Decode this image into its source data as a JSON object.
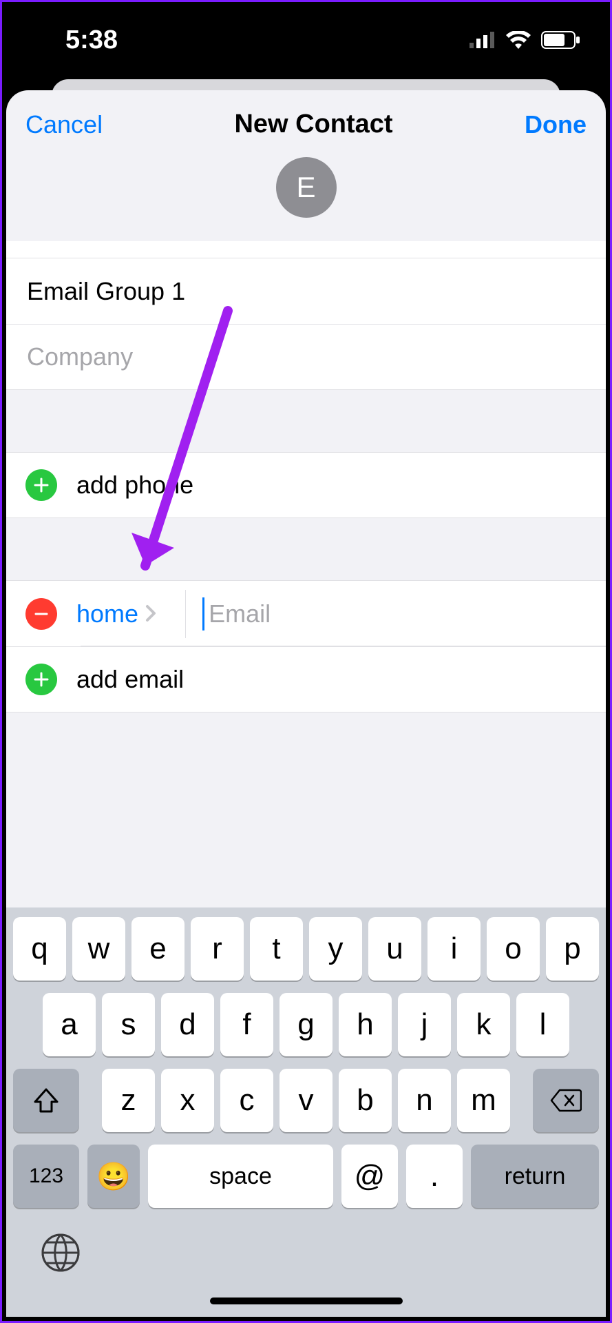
{
  "statusbar": {
    "time": "5:38"
  },
  "nav": {
    "cancel": "Cancel",
    "title": "New Contact",
    "done": "Done"
  },
  "avatar": {
    "initial": "E"
  },
  "name_field": {
    "value": "Email Group 1"
  },
  "company_field": {
    "placeholder": "Company",
    "value": ""
  },
  "phone_section": {
    "add_label": "add phone"
  },
  "email_section": {
    "type_label": "home",
    "email_placeholder": "Email",
    "email_value": "",
    "add_label": "add email"
  },
  "keyboard": {
    "row1": [
      "q",
      "w",
      "e",
      "r",
      "t",
      "y",
      "u",
      "i",
      "o",
      "p"
    ],
    "row2": [
      "a",
      "s",
      "d",
      "f",
      "g",
      "h",
      "j",
      "k",
      "l"
    ],
    "row3": [
      "z",
      "x",
      "c",
      "v",
      "b",
      "n",
      "m"
    ],
    "numkey": "123",
    "space": "space",
    "at": "@",
    "dot": ".",
    "return": "return"
  }
}
